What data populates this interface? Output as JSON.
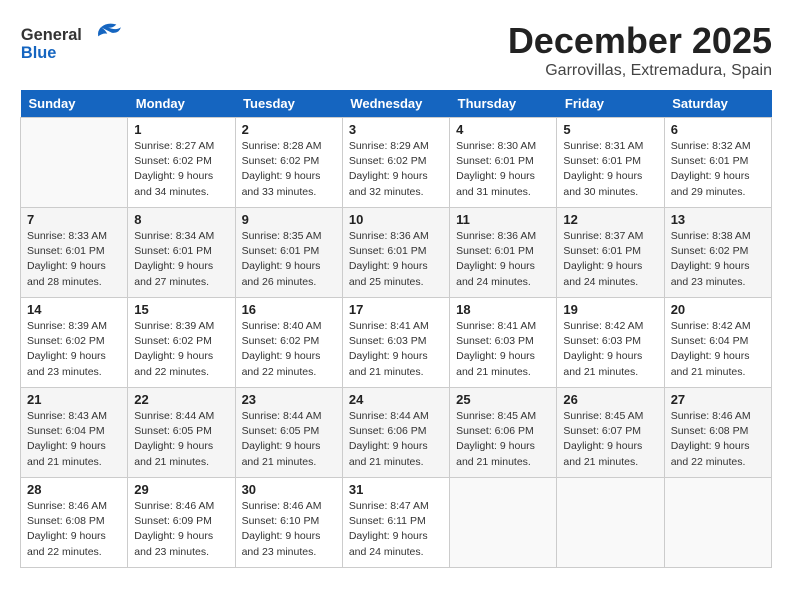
{
  "header": {
    "logo_general": "General",
    "logo_blue": "Blue",
    "month": "December 2025",
    "location": "Garrovillas, Extremadura, Spain"
  },
  "days_of_week": [
    "Sunday",
    "Monday",
    "Tuesday",
    "Wednesday",
    "Thursday",
    "Friday",
    "Saturday"
  ],
  "weeks": [
    [
      {
        "day": "",
        "info": ""
      },
      {
        "day": "1",
        "info": "Sunrise: 8:27 AM\nSunset: 6:02 PM\nDaylight: 9 hours\nand 34 minutes."
      },
      {
        "day": "2",
        "info": "Sunrise: 8:28 AM\nSunset: 6:02 PM\nDaylight: 9 hours\nand 33 minutes."
      },
      {
        "day": "3",
        "info": "Sunrise: 8:29 AM\nSunset: 6:02 PM\nDaylight: 9 hours\nand 32 minutes."
      },
      {
        "day": "4",
        "info": "Sunrise: 8:30 AM\nSunset: 6:01 PM\nDaylight: 9 hours\nand 31 minutes."
      },
      {
        "day": "5",
        "info": "Sunrise: 8:31 AM\nSunset: 6:01 PM\nDaylight: 9 hours\nand 30 minutes."
      },
      {
        "day": "6",
        "info": "Sunrise: 8:32 AM\nSunset: 6:01 PM\nDaylight: 9 hours\nand 29 minutes."
      }
    ],
    [
      {
        "day": "7",
        "info": "Sunrise: 8:33 AM\nSunset: 6:01 PM\nDaylight: 9 hours\nand 28 minutes."
      },
      {
        "day": "8",
        "info": "Sunrise: 8:34 AM\nSunset: 6:01 PM\nDaylight: 9 hours\nand 27 minutes."
      },
      {
        "day": "9",
        "info": "Sunrise: 8:35 AM\nSunset: 6:01 PM\nDaylight: 9 hours\nand 26 minutes."
      },
      {
        "day": "10",
        "info": "Sunrise: 8:36 AM\nSunset: 6:01 PM\nDaylight: 9 hours\nand 25 minutes."
      },
      {
        "day": "11",
        "info": "Sunrise: 8:36 AM\nSunset: 6:01 PM\nDaylight: 9 hours\nand 24 minutes."
      },
      {
        "day": "12",
        "info": "Sunrise: 8:37 AM\nSunset: 6:01 PM\nDaylight: 9 hours\nand 24 minutes."
      },
      {
        "day": "13",
        "info": "Sunrise: 8:38 AM\nSunset: 6:02 PM\nDaylight: 9 hours\nand 23 minutes."
      }
    ],
    [
      {
        "day": "14",
        "info": "Sunrise: 8:39 AM\nSunset: 6:02 PM\nDaylight: 9 hours\nand 23 minutes."
      },
      {
        "day": "15",
        "info": "Sunrise: 8:39 AM\nSunset: 6:02 PM\nDaylight: 9 hours\nand 22 minutes."
      },
      {
        "day": "16",
        "info": "Sunrise: 8:40 AM\nSunset: 6:02 PM\nDaylight: 9 hours\nand 22 minutes."
      },
      {
        "day": "17",
        "info": "Sunrise: 8:41 AM\nSunset: 6:03 PM\nDaylight: 9 hours\nand 21 minutes."
      },
      {
        "day": "18",
        "info": "Sunrise: 8:41 AM\nSunset: 6:03 PM\nDaylight: 9 hours\nand 21 minutes."
      },
      {
        "day": "19",
        "info": "Sunrise: 8:42 AM\nSunset: 6:03 PM\nDaylight: 9 hours\nand 21 minutes."
      },
      {
        "day": "20",
        "info": "Sunrise: 8:42 AM\nSunset: 6:04 PM\nDaylight: 9 hours\nand 21 minutes."
      }
    ],
    [
      {
        "day": "21",
        "info": "Sunrise: 8:43 AM\nSunset: 6:04 PM\nDaylight: 9 hours\nand 21 minutes."
      },
      {
        "day": "22",
        "info": "Sunrise: 8:44 AM\nSunset: 6:05 PM\nDaylight: 9 hours\nand 21 minutes."
      },
      {
        "day": "23",
        "info": "Sunrise: 8:44 AM\nSunset: 6:05 PM\nDaylight: 9 hours\nand 21 minutes."
      },
      {
        "day": "24",
        "info": "Sunrise: 8:44 AM\nSunset: 6:06 PM\nDaylight: 9 hours\nand 21 minutes."
      },
      {
        "day": "25",
        "info": "Sunrise: 8:45 AM\nSunset: 6:06 PM\nDaylight: 9 hours\nand 21 minutes."
      },
      {
        "day": "26",
        "info": "Sunrise: 8:45 AM\nSunset: 6:07 PM\nDaylight: 9 hours\nand 21 minutes."
      },
      {
        "day": "27",
        "info": "Sunrise: 8:46 AM\nSunset: 6:08 PM\nDaylight: 9 hours\nand 22 minutes."
      }
    ],
    [
      {
        "day": "28",
        "info": "Sunrise: 8:46 AM\nSunset: 6:08 PM\nDaylight: 9 hours\nand 22 minutes."
      },
      {
        "day": "29",
        "info": "Sunrise: 8:46 AM\nSunset: 6:09 PM\nDaylight: 9 hours\nand 23 minutes."
      },
      {
        "day": "30",
        "info": "Sunrise: 8:46 AM\nSunset: 6:10 PM\nDaylight: 9 hours\nand 23 minutes."
      },
      {
        "day": "31",
        "info": "Sunrise: 8:47 AM\nSunset: 6:11 PM\nDaylight: 9 hours\nand 24 minutes."
      },
      {
        "day": "",
        "info": ""
      },
      {
        "day": "",
        "info": ""
      },
      {
        "day": "",
        "info": ""
      }
    ]
  ]
}
